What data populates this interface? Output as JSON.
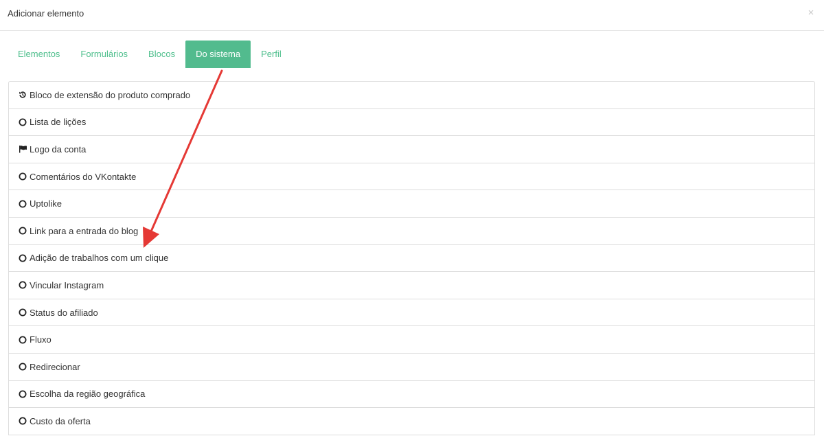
{
  "dialog": {
    "title": "Adicionar elemento",
    "close_symbol": "×"
  },
  "tabs": [
    {
      "label": "Elementos",
      "active": false
    },
    {
      "label": "Formulários",
      "active": false
    },
    {
      "label": "Blocos",
      "active": false
    },
    {
      "label": "Do sistema",
      "active": true
    },
    {
      "label": "Perfil",
      "active": false
    }
  ],
  "items": [
    {
      "label": "Bloco de extensão do produto comprado",
      "icon": "history-icon"
    },
    {
      "label": "Lista de lições",
      "icon": "circle-icon"
    },
    {
      "label": "Logo da conta",
      "icon": "flag-icon"
    },
    {
      "label": "Comentários do VKontakte",
      "icon": "circle-icon"
    },
    {
      "label": "Uptolike",
      "icon": "circle-icon"
    },
    {
      "label": "Link para a entrada do blog",
      "icon": "circle-icon"
    },
    {
      "label": "Adição de trabalhos com um clique",
      "icon": "circle-icon"
    },
    {
      "label": "Vincular Instagram",
      "icon": "circle-icon"
    },
    {
      "label": "Status do afiliado",
      "icon": "circle-icon"
    },
    {
      "label": "Fluxo",
      "icon": "circle-icon"
    },
    {
      "label": "Redirecionar",
      "icon": "circle-icon"
    },
    {
      "label": "Escolha da região geográfica",
      "icon": "circle-icon"
    },
    {
      "label": "Custo da oferta",
      "icon": "circle-icon"
    }
  ],
  "colors": {
    "accent": "#52bb8e",
    "tab_text": "#4fbf8d",
    "annotation_arrow": "#e53935"
  }
}
